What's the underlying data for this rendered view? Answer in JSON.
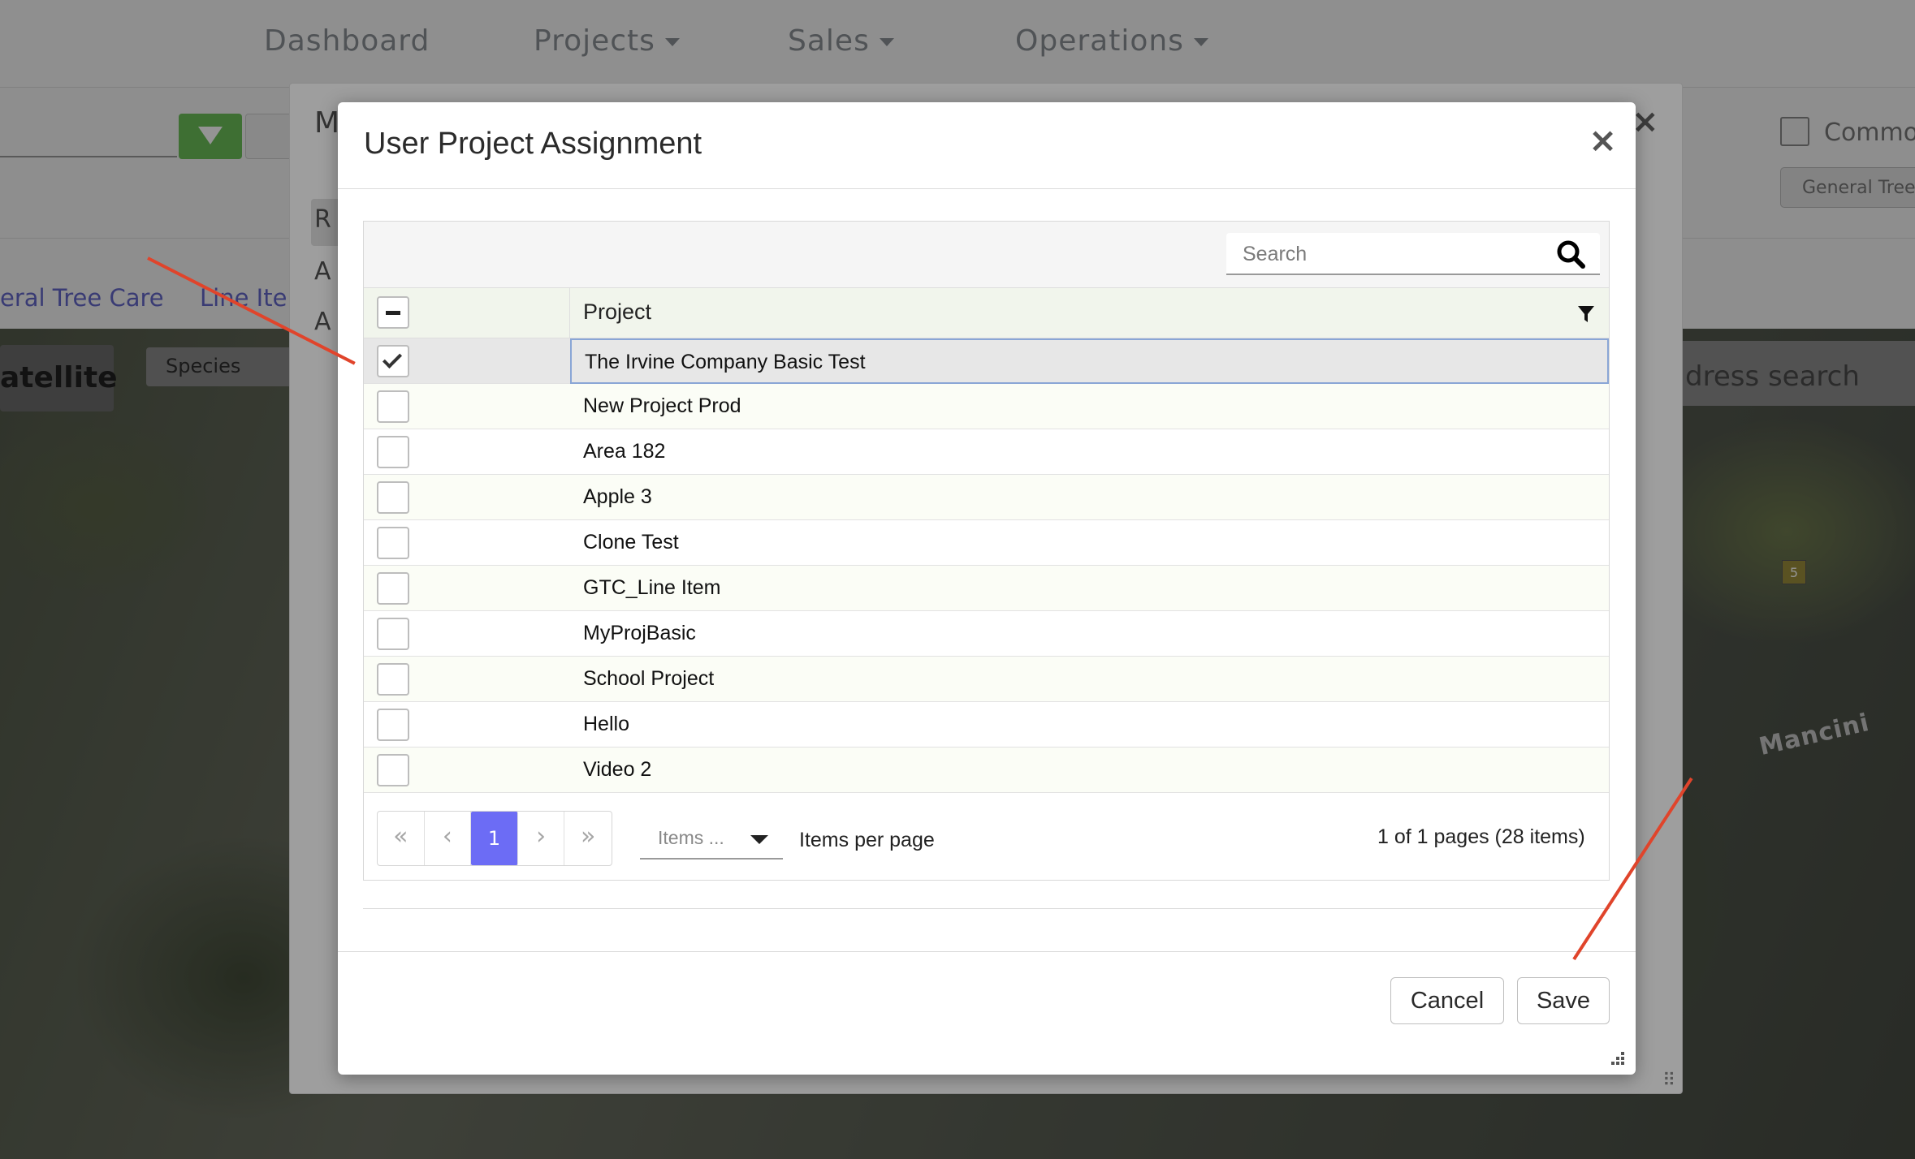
{
  "topnav": {
    "items": [
      {
        "label": "Dashboard",
        "has_caret": false
      },
      {
        "label": "Projects",
        "has_caret": true
      },
      {
        "label": "Sales",
        "has_caret": true
      },
      {
        "label": "Operations",
        "has_caret": true
      }
    ]
  },
  "background": {
    "subtabs": [
      "eral Tree Care",
      "Line Iter"
    ],
    "map_button": "atellite",
    "species_button": "Species",
    "address_search": "dress search",
    "map_label": "Mancini",
    "map_marker": "5",
    "right_checkbox_label": "Commor",
    "right_button": "General Tree",
    "back_modal": {
      "title": "M",
      "letters": [
        "R",
        "A",
        "A"
      ]
    }
  },
  "modal": {
    "title": "User Project Assignment",
    "close_glyph": "×",
    "search": {
      "placeholder": "Search",
      "value": ""
    },
    "column_header": "Project",
    "header_checkbox_state": "indeterminate",
    "rows": [
      {
        "name": "The Irvine Company Basic Test",
        "checked": true
      },
      {
        "name": "New Project Prod",
        "checked": false
      },
      {
        "name": "Area 182",
        "checked": false
      },
      {
        "name": "Apple 3",
        "checked": false
      },
      {
        "name": "Clone Test",
        "checked": false
      },
      {
        "name": "GTC_Line Item",
        "checked": false
      },
      {
        "name": "MyProjBasic",
        "checked": false
      },
      {
        "name": "School Project",
        "checked": false
      },
      {
        "name": "Hello",
        "checked": false
      },
      {
        "name": "Video 2",
        "checked": false
      }
    ],
    "pager": {
      "first": "«",
      "prev": "‹",
      "current_page": "1",
      "next": "›",
      "last": "»",
      "items_select_value": "Items ...",
      "items_per_page_label": "Items per page",
      "info": "1 of 1 pages (28 items)"
    },
    "buttons": {
      "cancel": "Cancel",
      "save": "Save"
    }
  },
  "colors": {
    "accent": "#6c6cf5",
    "annotation_arrow": "#e0442b",
    "header_bg": "#f1f5ec",
    "selected_row_border": "#8aa6d6"
  }
}
